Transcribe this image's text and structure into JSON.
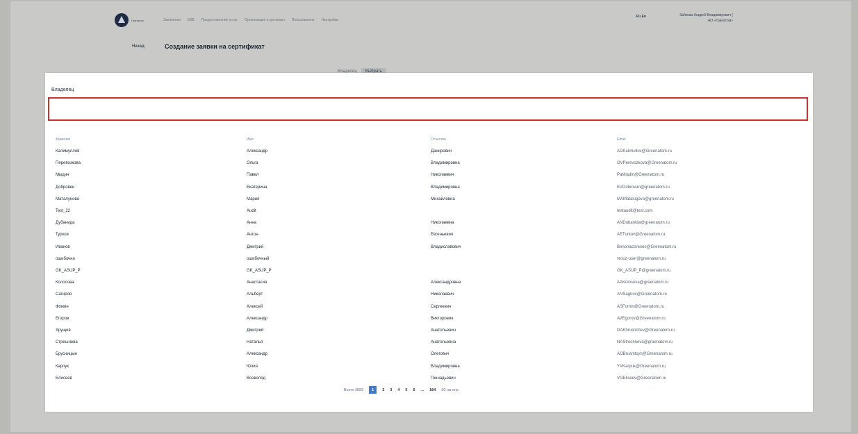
{
  "header": {
    "logo_text": "Гринатом",
    "nav": [
      "Заявления",
      "ЕКВ",
      "Предоставление услуг",
      "Организации и договоры",
      "Пользователи",
      "Настройки"
    ],
    "lang": "Ru En",
    "user_name": "Зайкова Андрей Владимирович (",
    "user_org": "АО «Гринатом»"
  },
  "breadcrumb": {
    "home": "Назад"
  },
  "page_title": "Создание заявки на сертификат",
  "tabs": [
    "Владелец",
    "Выбрать"
  ],
  "owner": {
    "label": "Владелец",
    "value": ""
  },
  "table": {
    "headers": [
      "Фамилия",
      "Имя",
      "Отчество",
      "Email"
    ],
    "rows": [
      [
        "Калимуллов",
        "Александр",
        "Данирович",
        "ADKalimullov@Greenatom.ru"
      ],
      [
        "Перевозкова",
        "Ольга",
        "Владимировна",
        "OVPerevozkova@Greenatom.ru"
      ],
      [
        "Мыдин",
        "Павел",
        "Николаевич",
        "PaMladin@Greenatom.ru"
      ],
      [
        "Добровен",
        "Екатерина",
        "Владимировна",
        "EVDobrovan@greenatom.ru"
      ],
      [
        "Маталунова",
        "Мария",
        "Михайловна",
        "MAMatalugova@greenatom.ru"
      ],
      [
        "Test_22",
        "Audit",
        "",
        "testaudit@test.com"
      ],
      [
        "Дубанида",
        "Анна",
        "Николаевна",
        "ANDubanida@greenatom.ru"
      ],
      [
        "Турков",
        "Антон",
        "Евгеньевич",
        "AETurkov@Greenatom.ru"
      ],
      [
        "Иванов",
        "Дмитрий",
        "Владиславович",
        "Benonactivexes@Greenatom.ru"
      ],
      [
        "ошибочно",
        "ошибочный",
        "",
        "vrouz-user@greenatom.ru"
      ],
      [
        "GK_ASUP_P",
        "GK_ASUP_P",
        "",
        "GK_ASUP_P@greenatom.ru"
      ],
      [
        "Колосова",
        "Анастасия",
        "Александровна",
        "AAKolosova@greenatom.ru"
      ],
      [
        "Сагиров",
        "Альберт",
        "Николаевич",
        "ANSagirov@Greenatom.ru"
      ],
      [
        "Фомин",
        "Алексей",
        "Сергеевич",
        "ASFomin@Greenatom.ru"
      ],
      [
        "Егоров",
        "Александр",
        "Викторович",
        "AVEgorov@Greenatom.ru"
      ],
      [
        "Хрущев",
        "Дмитрий",
        "Анатольевич",
        "DAKhrushchev@Greenatom.ru"
      ],
      [
        "Стрешнева",
        "Наталья",
        "Анатольевна",
        "NAStreshneva@greenatom.ru"
      ],
      [
        "Брусницын",
        "Александр",
        "Олегович",
        "AOBrusnitsyn@Greenatom.ru"
      ],
      [
        "Карпук",
        "Юлия",
        "Владимировна",
        "YVKarpuk@Greenatom.ru"
      ],
      [
        "Елисеев",
        "Всеволод",
        "Геннадьевич",
        "VGEliseev@Greenatom.ru"
      ]
    ]
  },
  "pagination": {
    "total": "Всего 3682",
    "pages": [
      "1",
      "2",
      "3",
      "4",
      "5",
      "6",
      "...",
      "184"
    ],
    "active": "1",
    "per_page": "20 на стр."
  },
  "colors": {
    "accent": "#3f79c8",
    "error_border": "#c9332f",
    "header_text": "#6a8cb7"
  }
}
